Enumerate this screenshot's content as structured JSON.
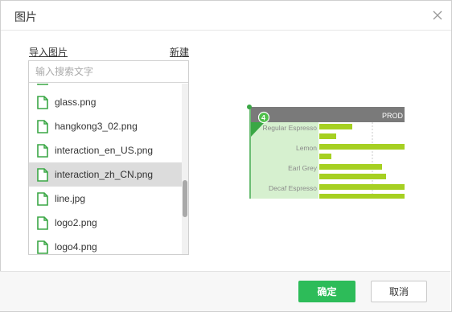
{
  "dialog": {
    "title": "图片",
    "import_label": "导入图片",
    "new_label": "新建",
    "search_placeholder": "输入搜索文字",
    "files": [
      "glass.png",
      "hangkong3_02.png",
      "interaction_en_US.png",
      "interaction_zh_CN.png",
      "line.jpg",
      "logo2.png",
      "logo4.png"
    ],
    "selected_file": "interaction_zh_CN.png",
    "ok_label": "确定",
    "cancel_label": "取消"
  },
  "preview": {
    "badge": "4",
    "header_text": "PROD",
    "categories": [
      "Regular Espresso",
      "Lemon",
      "Earl Grey",
      "Decaf Espresso"
    ]
  },
  "colors": {
    "accent_green": "#2dbc59",
    "file_icon_green": "#3aa745",
    "preview_bar": "#a6d022",
    "preview_header": "#7a7a7a",
    "preview_highlight": "#d6f0cf"
  },
  "icons": {
    "close": "close-icon",
    "file": "file-icon"
  }
}
